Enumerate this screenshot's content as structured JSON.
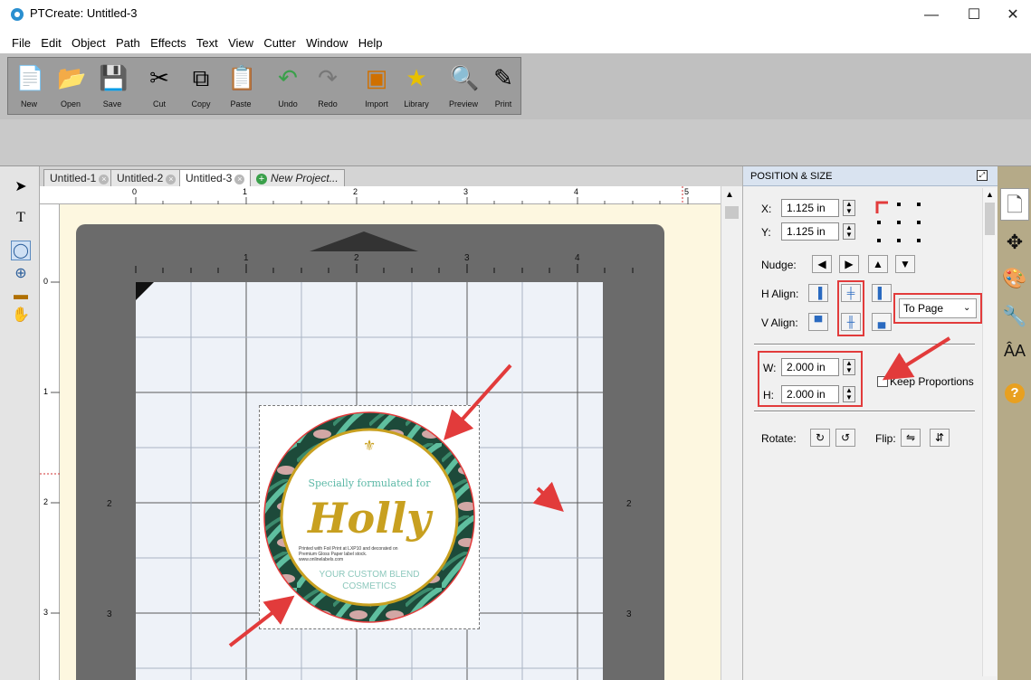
{
  "window": {
    "title": "PTCreate: Untitled-3",
    "minimize": "—",
    "maximize": "☐",
    "close": "✕"
  },
  "menu": [
    "File",
    "Edit",
    "Object",
    "Path",
    "Effects",
    "Text",
    "View",
    "Cutter",
    "Window",
    "Help"
  ],
  "toolbar": [
    {
      "label": "New",
      "icon": "new-doc-icon"
    },
    {
      "label": "Open",
      "icon": "open-folder-icon"
    },
    {
      "label": "Save",
      "icon": "save-icon"
    },
    {
      "label": "Cut",
      "icon": "cut-icon"
    },
    {
      "label": "Copy",
      "icon": "copy-icon"
    },
    {
      "label": "Paste",
      "icon": "paste-icon"
    },
    {
      "label": "Undo",
      "icon": "undo-icon"
    },
    {
      "label": "Redo",
      "icon": "redo-icon"
    },
    {
      "label": "Import",
      "icon": "import-icon"
    },
    {
      "label": "Library",
      "icon": "library-icon"
    },
    {
      "label": "Preview",
      "icon": "preview-icon"
    },
    {
      "label": "Print",
      "icon": "print-icon"
    }
  ],
  "tabs": [
    {
      "label": "Untitled-1",
      "closable": "×"
    },
    {
      "label": "Untitled-2",
      "closable": "×"
    },
    {
      "label": "Untitled-3",
      "closable": "×"
    },
    {
      "label": "New Project...",
      "closable": ""
    }
  ],
  "ruler": {
    "top_ticks": [
      "0",
      "1",
      "2",
      "3",
      "4",
      "5"
    ],
    "left_ticks": [
      "0",
      "1",
      "2",
      "3"
    ],
    "mat_top": [
      "1",
      "2",
      "3",
      "4"
    ],
    "mat_side": [
      "2",
      "3"
    ]
  },
  "label": {
    "subtitle": "Specially formulated for",
    "name": "Holly",
    "fine_print": "Printed with Foil Print at LXP10 and decorated on Premium Gloss Paper label stock. www.onlinelabels.com",
    "brand_line1": "YOUR CUSTOM BLEND",
    "brand_line2": "COSMETICS"
  },
  "panel": {
    "title": "POSITION & SIZE",
    "x_label": "X:",
    "x_value": "1.125 in",
    "y_label": "Y:",
    "y_value": "1.125 in",
    "nudge_label": "Nudge:",
    "halign_label": "H Align:",
    "valign_label": "V Align:",
    "align_target": "To Page",
    "w_label": "W:",
    "w_value": "2.000 in",
    "h_label": "H:",
    "h_value": "2.000 in",
    "keep_proportions": "Keep Proportions",
    "rotate_label": "Rotate:",
    "flip_label": "Flip:"
  },
  "colors": {
    "annotation_red": "#e23b3b",
    "label_gold": "#c8a020",
    "label_teal": "#5bb8a6",
    "mat_gray": "#6b6b6b"
  }
}
